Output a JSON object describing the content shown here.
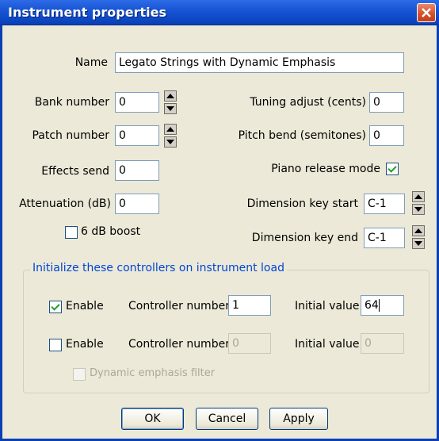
{
  "window": {
    "title": "Instrument properties"
  },
  "fields": {
    "name": {
      "label": "Name",
      "value": "Legato Strings with Dynamic Emphasis"
    },
    "bank_number": {
      "label": "Bank number",
      "value": "0"
    },
    "patch_number": {
      "label": "Patch number",
      "value": "0"
    },
    "effects_send": {
      "label": "Effects send",
      "value": "0"
    },
    "attenuation": {
      "label": "Attenuation (dB)",
      "value": "0"
    },
    "tuning_adjust": {
      "label": "Tuning adjust (cents)",
      "value": "0"
    },
    "pitch_bend": {
      "label": "Pitch bend (semitones)",
      "value": "0"
    },
    "piano_release": {
      "label": "Piano release mode",
      "checked": true
    },
    "dim_key_start": {
      "label": "Dimension key start",
      "value": "C-1"
    },
    "dim_key_end": {
      "label": "Dimension key end",
      "value": "C-1"
    },
    "boost": {
      "label": "6 dB boost",
      "checked": false
    }
  },
  "controllers": {
    "title": "Initialize these controllers on instrument load",
    "rows": [
      {
        "enable_label": "Enable",
        "enabled": true,
        "controller_label": "Controller number",
        "controller_value": "1",
        "initial_label": "Initial value",
        "initial_value": "64"
      },
      {
        "enable_label": "Enable",
        "enabled": false,
        "controller_label": "Controller number",
        "controller_value": "0",
        "initial_label": "Initial value",
        "initial_value": "0"
      }
    ],
    "dynamic_filter": {
      "label": "Dynamic emphasis filter",
      "checked": false
    }
  },
  "buttons": {
    "ok": "OK",
    "cancel": "Cancel",
    "apply": "Apply"
  }
}
